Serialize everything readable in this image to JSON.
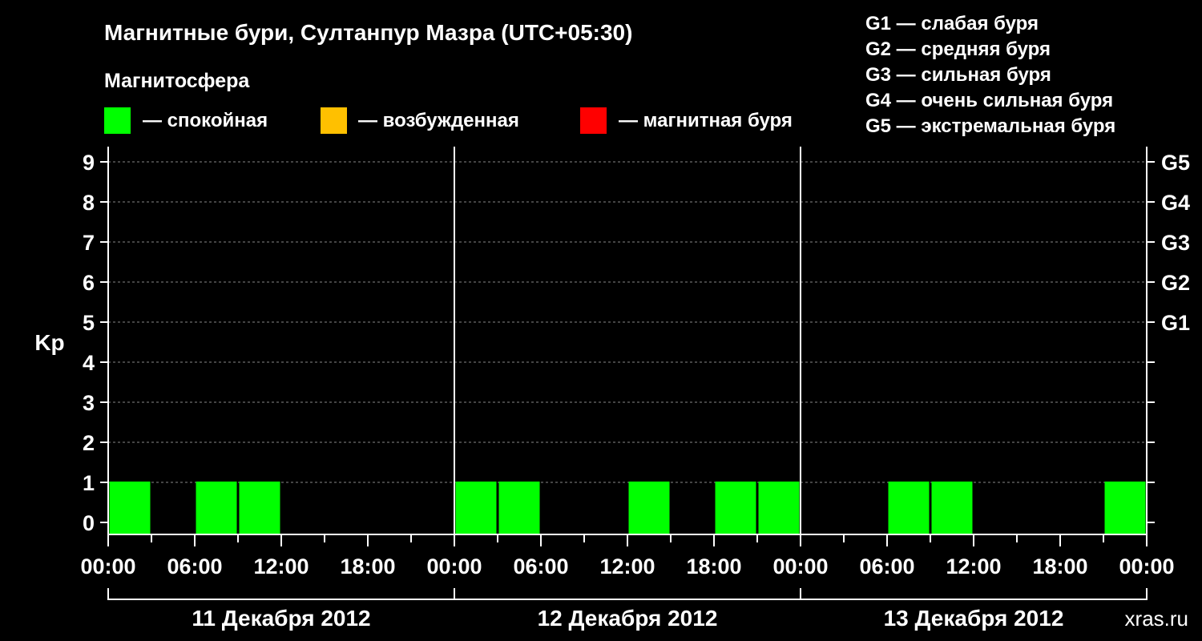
{
  "chart_data": {
    "type": "bar",
    "title": "Магнитные бури, Султанпур Мазра (UTC+05:30)",
    "legend_title": "Магнитосфера",
    "legend": [
      {
        "label": "— спокойная",
        "color": "#00ff00"
      },
      {
        "label": "— возбужденная",
        "color": "#ffc000"
      },
      {
        "label": "— магнитная буря",
        "color": "#ff0000"
      }
    ],
    "storm_scale": [
      {
        "level": "G1",
        "label": "G1 — слабая буря",
        "kp": 5
      },
      {
        "level": "G2",
        "label": "G2 — средняя буря",
        "kp": 6
      },
      {
        "level": "G3",
        "label": "G3 — сильная буря",
        "kp": 7
      },
      {
        "level": "G4",
        "label": "G4 — очень сильная буря",
        "kp": 8
      },
      {
        "level": "G5",
        "label": "G5 — экстремальная буря",
        "kp": 9
      }
    ],
    "ylabel": "Kp",
    "ylim": [
      0,
      9
    ],
    "yticks": [
      "0",
      "1",
      "2",
      "3",
      "4",
      "5",
      "6",
      "7",
      "8",
      "9"
    ],
    "xticks": [
      "00:00",
      "06:00",
      "12:00",
      "18:00",
      "00:00",
      "06:00",
      "12:00",
      "18:00",
      "00:00",
      "06:00",
      "12:00",
      "18:00",
      "00:00"
    ],
    "days": [
      "11 Декабря 2012",
      "12 Декабря 2012",
      "13 Декабря 2012"
    ],
    "hours_total": 72,
    "grid": true,
    "series": [
      {
        "values": [
          {
            "start_hour": 0,
            "kp": 1,
            "color": "#00ff00"
          },
          {
            "start_hour": 6,
            "kp": 1,
            "color": "#00ff00"
          },
          {
            "start_hour": 9,
            "kp": 1,
            "color": "#00ff00"
          },
          {
            "start_hour": 24,
            "kp": 1,
            "color": "#00ff00"
          },
          {
            "start_hour": 27,
            "kp": 1,
            "color": "#00ff00"
          },
          {
            "start_hour": 36,
            "kp": 1,
            "color": "#00ff00"
          },
          {
            "start_hour": 42,
            "kp": 1,
            "color": "#00ff00"
          },
          {
            "start_hour": 45,
            "kp": 1,
            "color": "#00ff00"
          },
          {
            "start_hour": 54,
            "kp": 1,
            "color": "#00ff00"
          },
          {
            "start_hour": 57,
            "kp": 1,
            "color": "#00ff00"
          },
          {
            "start_hour": 69,
            "kp": 1,
            "color": "#00ff00"
          }
        ]
      }
    ]
  },
  "watermark": "xras.ru"
}
